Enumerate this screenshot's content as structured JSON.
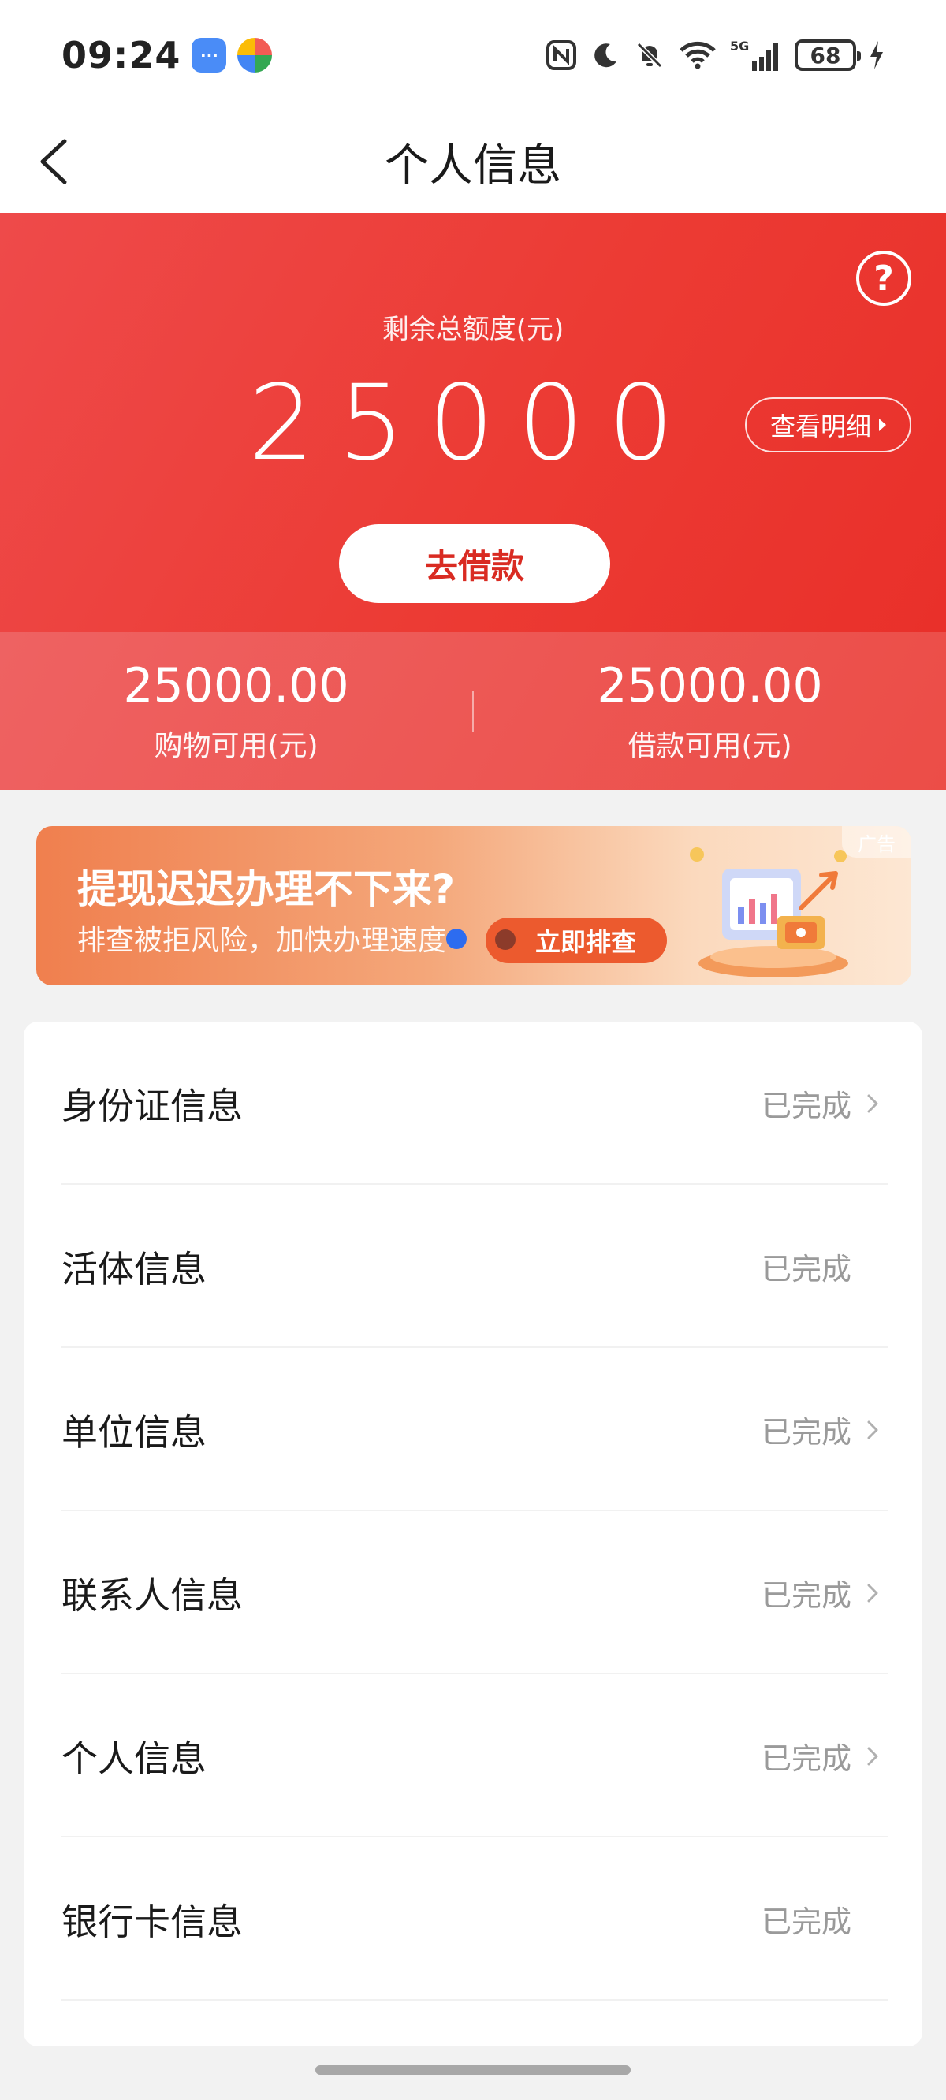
{
  "status_bar": {
    "time": "09:24",
    "battery": "68",
    "network": "5G"
  },
  "nav": {
    "title": "个人信息"
  },
  "hero": {
    "label": "剩余总额度(元)",
    "amount": "25000",
    "detail_label": "查看明细",
    "borrow_label": "去借款",
    "help_symbol": "?"
  },
  "limits": {
    "shopping": {
      "value": "25000.00",
      "label": "购物可用(元)"
    },
    "loan": {
      "value": "25000.00",
      "label": "借款可用(元)"
    }
  },
  "ad": {
    "title": "提现迟迟办理不下来?",
    "subtitle": "排查被拒风险，加快办理速度",
    "cta": "立即排查",
    "tag": "广告"
  },
  "info_items": [
    {
      "label": "身份证信息",
      "status": "已完成",
      "has_chevron": true
    },
    {
      "label": "活体信息",
      "status": "已完成",
      "has_chevron": false
    },
    {
      "label": "单位信息",
      "status": "已完成",
      "has_chevron": true
    },
    {
      "label": "联系人信息",
      "status": "已完成",
      "has_chevron": true
    },
    {
      "label": "个人信息",
      "status": "已完成",
      "has_chevron": true
    },
    {
      "label": "银行卡信息",
      "status": "已完成",
      "has_chevron": false
    }
  ],
  "colors": {
    "brand_red": "#e9302a",
    "borrow_text": "#d92b22",
    "status_gray": "#9a9a9a"
  }
}
